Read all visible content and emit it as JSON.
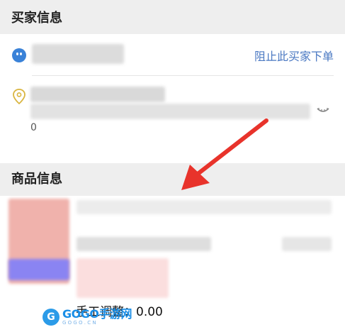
{
  "buyer_section": {
    "title": "买家信息",
    "block_buyer_label": "阻止此买家下单",
    "address_trailing": "0"
  },
  "goods_section": {
    "title": "商品信息",
    "manual_adjustment": "手工调整：0.00"
  },
  "watermark": {
    "brand": "GOGO手游网",
    "sub": "G O G O . C N"
  },
  "icons": {
    "buyer_avatar": "buyer-avatar-icon",
    "location": "location-pin-icon",
    "expand": "expand-icon"
  },
  "colors": {
    "section_header_bg": "#eeeeee",
    "link": "#4a78c2",
    "annotation_arrow": "#e8332b"
  }
}
